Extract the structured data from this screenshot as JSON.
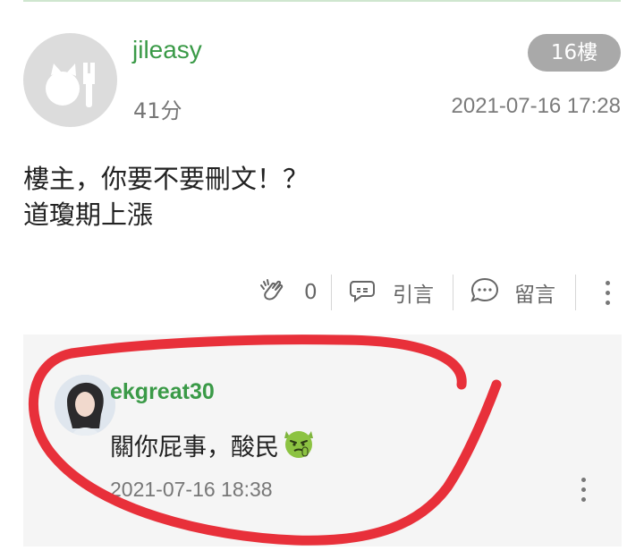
{
  "post": {
    "username": "jileasy",
    "score": "41分",
    "floor": "16樓",
    "time": "2021-07-16 17:28",
    "content_lines": [
      "樓主，你要不要刪文！？",
      "道瓊期上漲"
    ]
  },
  "actions": {
    "like_count": "0",
    "quote_label": "引言",
    "comment_label": "留言"
  },
  "comment": {
    "username": "ekgreat30",
    "text": "關你屁事，酸民",
    "time": "2021-07-16 18:38"
  },
  "colors": {
    "username_green": "#3a9a47",
    "annotation_red": "#e8303a",
    "badge_gray": "#a9a9a9"
  },
  "icons": [
    "default-avatar-icon",
    "clap-icon",
    "quote-icon",
    "comment-icon",
    "more-icon",
    "devil-emoji-icon"
  ]
}
